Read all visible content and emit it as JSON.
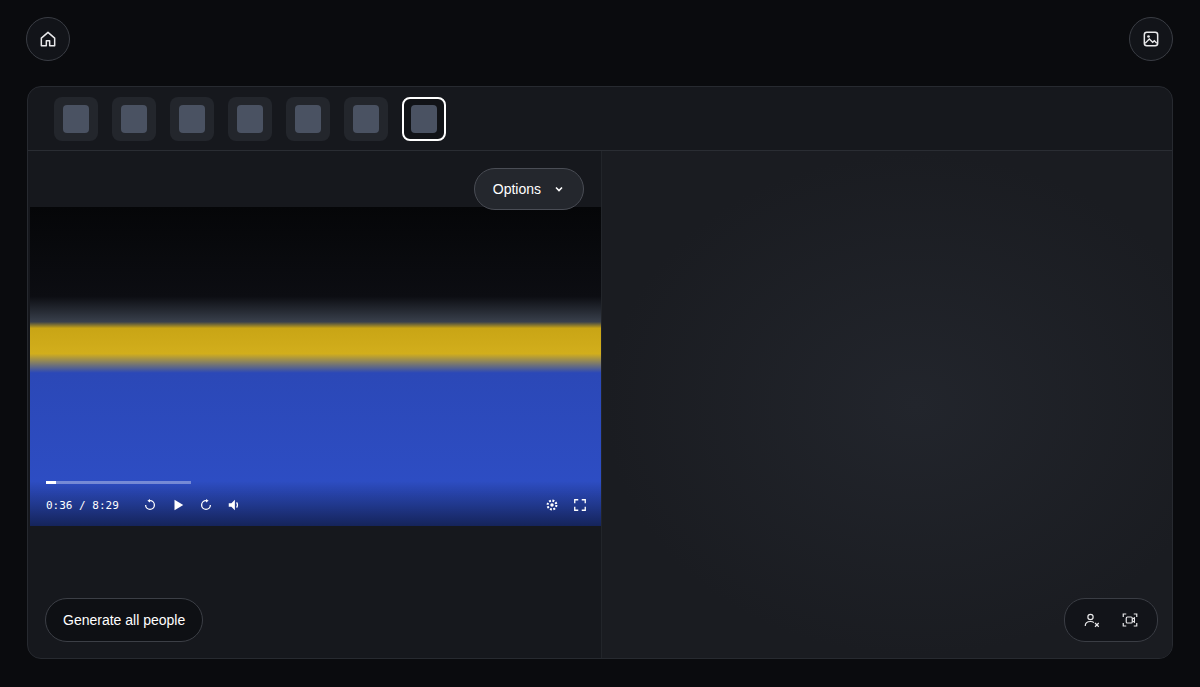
{
  "thumbnails": [
    {
      "selected": false
    },
    {
      "selected": false
    },
    {
      "selected": false
    },
    {
      "selected": false
    },
    {
      "selected": false
    },
    {
      "selected": false
    },
    {
      "selected": true
    }
  ],
  "options": {
    "label": "Options"
  },
  "player": {
    "time": "0:36 / 8:29",
    "level": 0.07
  },
  "generate_button": {
    "label": "Generate all people"
  }
}
